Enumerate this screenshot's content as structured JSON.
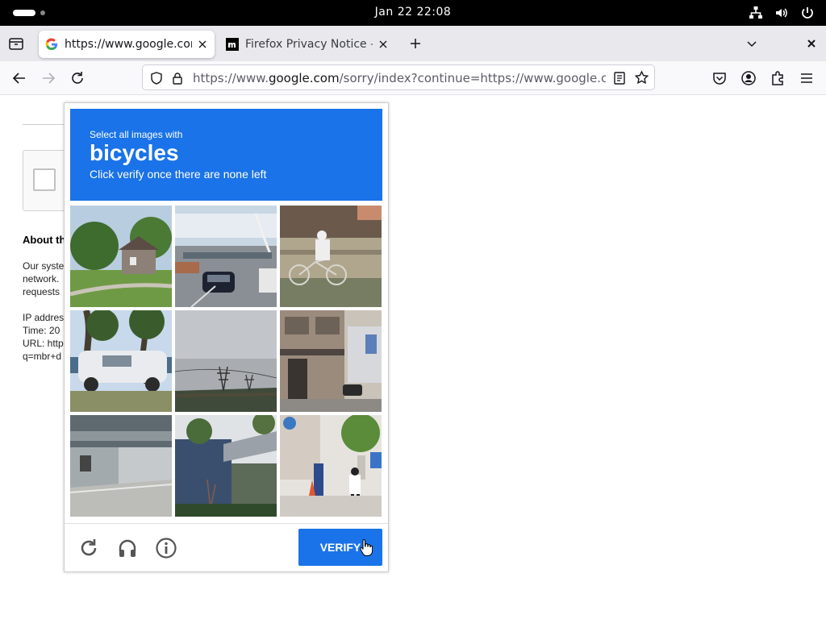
{
  "system_bar": {
    "clock": "Jan 22  22:08"
  },
  "tabs": [
    {
      "title": "https://www.google.com/sorry/index?continue=https://www.google.com/",
      "active": true,
      "favicon": "google-g-icon"
    },
    {
      "title": "Firefox Privacy Notice — Mozilla",
      "active": false,
      "favicon": "mozilla-m-icon"
    }
  ],
  "navbar": {
    "url_prefix": "https://www.",
    "url_domain": "google.com",
    "url_rest": "/sorry/index?continue=https://www.google.com/search"
  },
  "page": {
    "about_heading": "About th",
    "para1": [
      "Our syste",
      "network.",
      "requests"
    ],
    "para2": [
      "IP addres",
      "Time: 20",
      "URL: http",
      "q=mbr+d"
    ]
  },
  "captcha": {
    "line1": "Select all images with",
    "line2": "bicycles",
    "line3": "Click verify once there are none left",
    "verify_label": "VERIFY",
    "accent": "#1a73e8",
    "tiles": [
      {
        "name": "tile-house-lawn"
      },
      {
        "name": "tile-traffic-road"
      },
      {
        "name": "tile-cyclist-fence"
      },
      {
        "name": "tile-white-car-trees"
      },
      {
        "name": "tile-power-lines-sky"
      },
      {
        "name": "tile-shopfront-street"
      },
      {
        "name": "tile-concrete-building"
      },
      {
        "name": "tile-overpass-shrubs"
      },
      {
        "name": "tile-pedestrians-street"
      }
    ]
  }
}
